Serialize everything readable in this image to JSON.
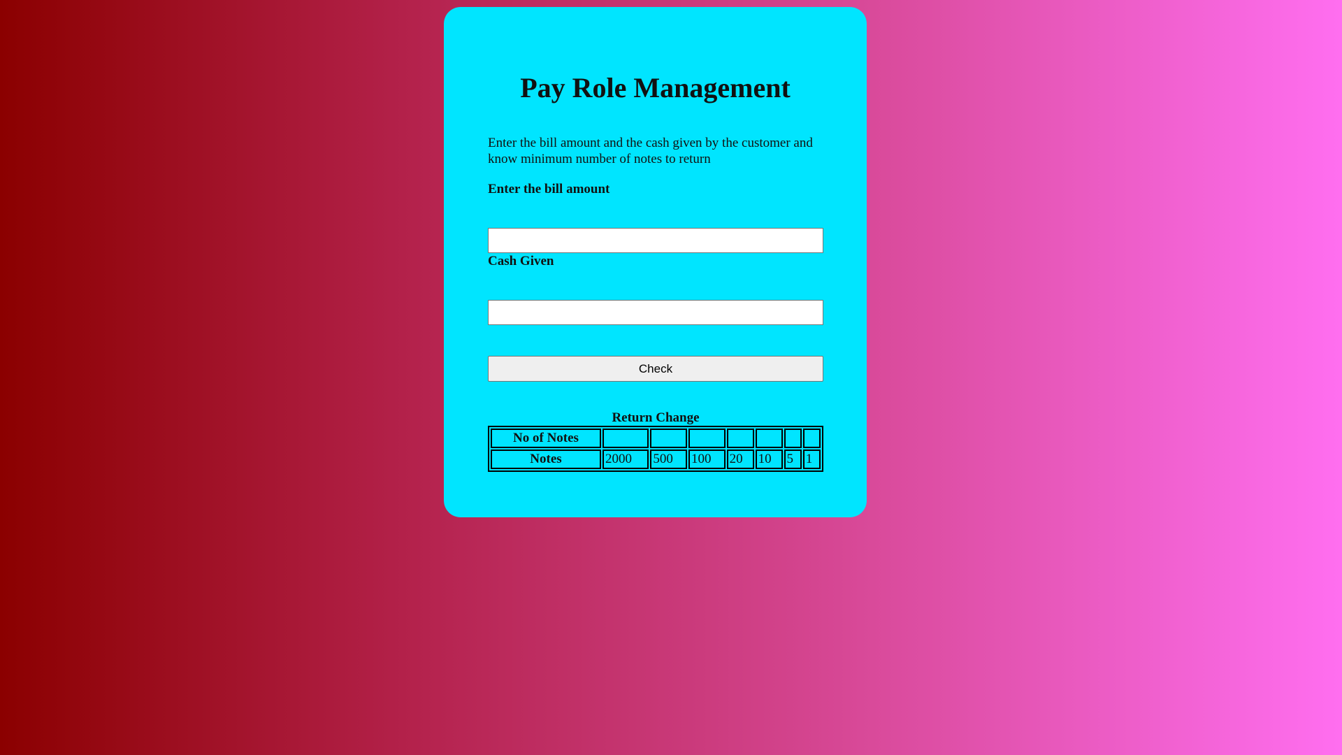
{
  "app": {
    "title": "Pay Role Management",
    "description": "Enter the bill amount and the cash given by the customer and know minimum number of notes to return"
  },
  "form": {
    "bill_label": "Enter the bill amount",
    "bill_value": "",
    "cash_label": "Cash Given",
    "cash_value": "",
    "check_button": "Check"
  },
  "change_table": {
    "caption": "Return Change",
    "row_headers": {
      "count": "No of Notes",
      "notes": "Notes"
    },
    "counts": [
      "",
      "",
      "",
      "",
      "",
      "",
      ""
    ],
    "notes": [
      "2000",
      "500",
      "100",
      "20",
      "10",
      "5",
      "1"
    ]
  },
  "colors": {
    "card_background": "#00e5ff",
    "gradient_start": "#8b0000",
    "gradient_end": "#ff6ef0"
  }
}
